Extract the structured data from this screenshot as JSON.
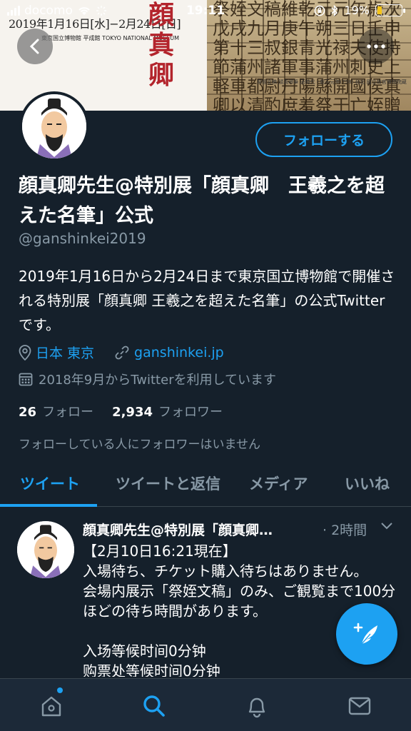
{
  "status_bar": {
    "carrier": "docomo",
    "time": "19:11",
    "battery": "19%"
  },
  "banner": {
    "poster_date": "2019年1月16日[水]−2月24日[日]",
    "museum": "東京国立博物館 平成館 TOKYO NATIONAL MUSEUM",
    "poster_title": "顔真卿",
    "calligraphy": "祭姪文稿維乾元元年歳次戊戌九月庚午朔三日壬申第十三叔銀青光禄夫使持節蒲州諸軍事蒲州刺史上軽車都尉丹陽縣開國侯真卿以清酌庶羞祭于亡姪贈贊善大夫季明之靈",
    "caption": "祭姪文稿 顔真卿筆 唐時代・乾元元年(758) 台北 國立故宮博物院蔵"
  },
  "profile": {
    "follow_label": "フォローする",
    "display_name": "顔真卿先生@特別展「顔真卿　王羲之を超えた名筆」公式",
    "handle": "@ganshinkei2019",
    "bio": "2019年1月16日から2月24日まで東京国立博物館で開催される特別展「顔真卿 王羲之を超えた名筆」の公式Twitterです。",
    "location": "日本 東京",
    "url": "ganshinkei.jp",
    "joined": "2018年9月からTwitterを利用しています",
    "following_count": "26",
    "following_label": "フォロー",
    "followers_count": "2,934",
    "followers_label": "フォロワー",
    "followers_note": "フォローしている人にフォロワーはいません"
  },
  "tabs": [
    {
      "label": "ツイート",
      "active": true
    },
    {
      "label": "ツイートと返信",
      "active": false
    },
    {
      "label": "メディア",
      "active": false
    },
    {
      "label": "いいね",
      "active": false
    }
  ],
  "tweet": {
    "name": "顔真卿先生@特別展「顔真卿…",
    "time": "· 2時間",
    "body": "【2月10日16:21現在】\n入場待ち、チケット購入待ちはありません。\n会場内展示「祭姪文稿」のみ、ご観覧まで100分ほどの待ち時間があります。\n\n入场等候时间0分钟\n购票处等候时间0分钟"
  },
  "colors": {
    "background": "#15202b",
    "accent": "#1da1f2",
    "muted": "#8899a6",
    "nav_bg": "#1c2938"
  },
  "icons": {
    "back": "back-arrow-icon",
    "more": "more-dots-icon",
    "location": "location-pin-icon",
    "link": "link-icon",
    "calendar": "calendar-icon",
    "compose": "compose-tweet-icon",
    "home": "home-icon",
    "search": "search-icon",
    "notifications": "bell-icon",
    "messages": "mail-icon"
  }
}
